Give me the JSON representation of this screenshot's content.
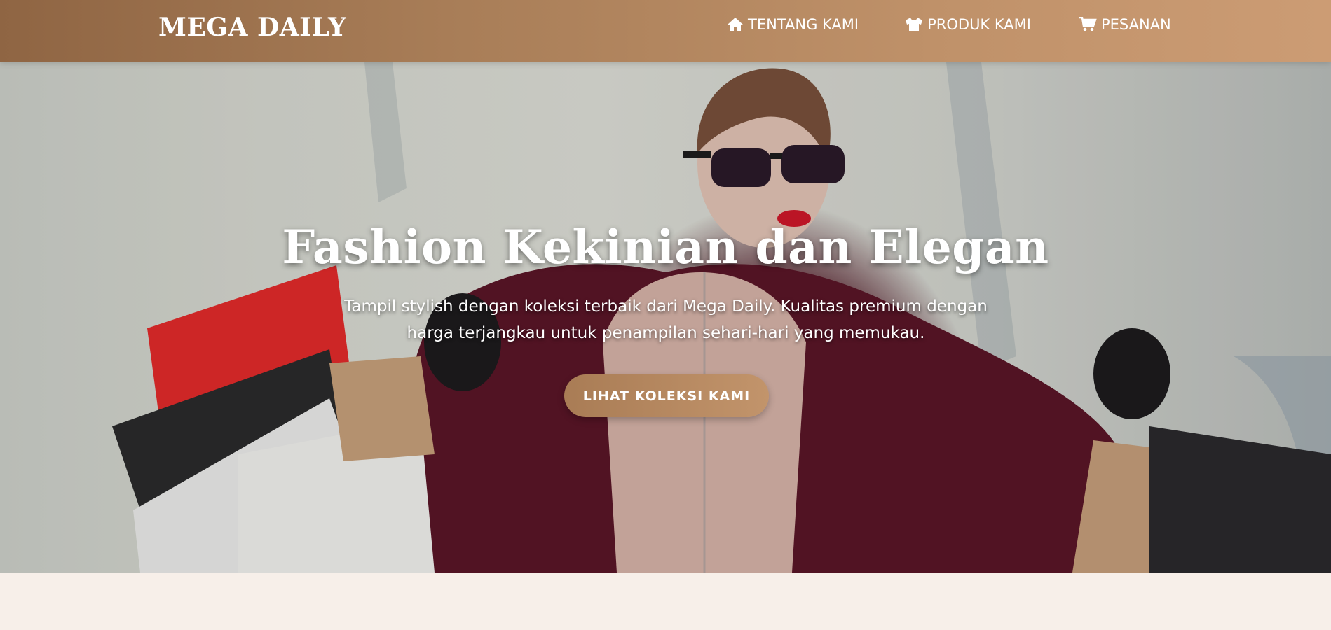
{
  "header": {
    "logo": "MEGA DAILY",
    "nav": [
      {
        "label": "TENTANG KAMI",
        "icon": "home-icon"
      },
      {
        "label": "PRODUK KAMI",
        "icon": "tshirt-icon"
      },
      {
        "label": "PESANAN",
        "icon": "cart-icon"
      }
    ]
  },
  "hero": {
    "title": "Fashion Kekinian dan Elegan",
    "subtitle": "Tampil stylish dengan koleksi terbaik dari Mega Daily. Kualitas premium dengan harga terjangkau untuk penampilan sehari-hari yang memukau.",
    "cta_label": "LIHAT KOLEKSI KAMI"
  },
  "colors": {
    "header_start": "#8f6543",
    "header_end": "#cc9c74",
    "accent": "#b88b62",
    "page_bg": "#f7efe9"
  }
}
